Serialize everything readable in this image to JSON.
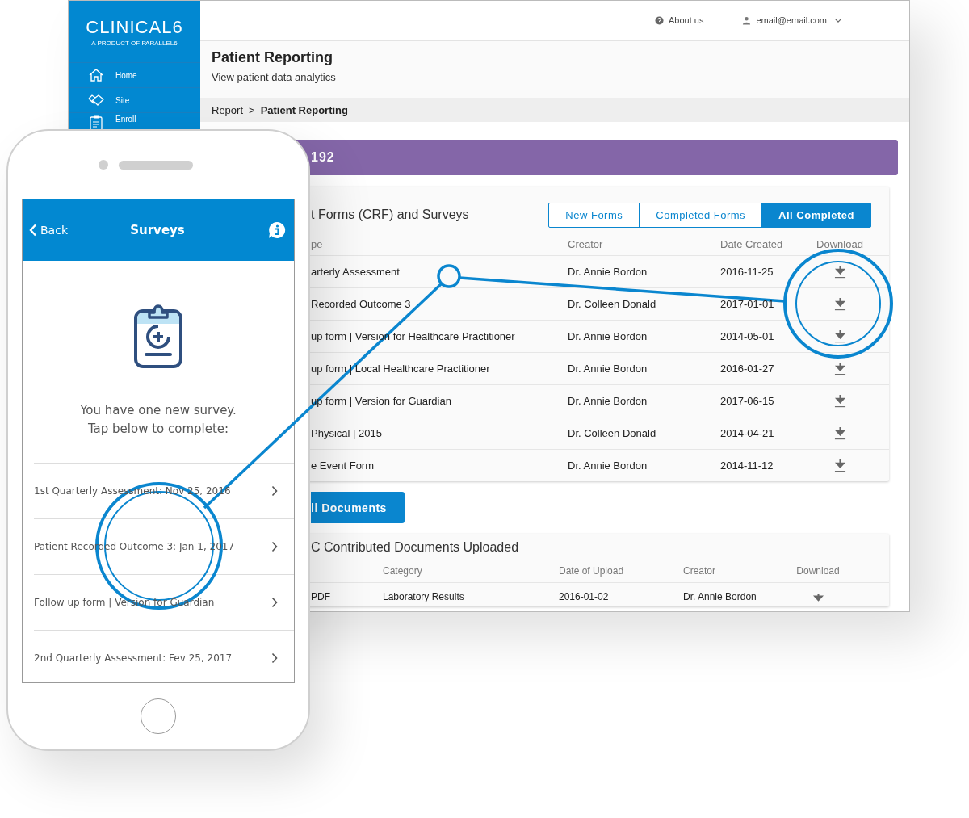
{
  "sidebar": {
    "logo": "CLINICAL6",
    "tagline": "A PRODUCT OF PARALLEL6",
    "items": [
      {
        "label": "Home",
        "kind": "home"
      },
      {
        "label": "Site",
        "kind": "handshake"
      },
      {
        "label": "Enroll",
        "kind": "clipboard"
      }
    ]
  },
  "topbar": {
    "links": [
      {
        "label": "About us",
        "kind": "help"
      },
      {
        "label": "email@email.com",
        "kind": "user"
      }
    ]
  },
  "header": {
    "title": "Patient Reporting",
    "subtitle": "View patient data analytics"
  },
  "breadcrumb": {
    "items": [
      "Report",
      "Patient Reporting"
    ],
    "separator": ">"
  },
  "banner": {
    "title": "192"
  },
  "forms_card": {
    "title": "t Forms (CRF) and Surveys",
    "tabs": [
      {
        "label": "New Forms",
        "selected": false
      },
      {
        "label": "Completed Forms",
        "selected": false
      },
      {
        "label": "All Completed",
        "selected": true
      }
    ],
    "columns": [
      "pe",
      "Creator",
      "Date Created",
      "Download"
    ],
    "rows": [
      {
        "type": "arterly Assessment",
        "creator": "Dr. Annie Bordon",
        "date": "2016-11-25"
      },
      {
        "type": "Recorded Outcome 3",
        "creator": "Dr. Colleen Donald",
        "date": "2017-01-01"
      },
      {
        "type": "up form | Version for Healthcare Practitioner",
        "creator": "Dr. Annie Bordon",
        "date": "2014-05-01"
      },
      {
        "type": "up form | Local Healthcare Practitioner",
        "creator": "Dr. Annie Bordon",
        "date": "2016-01-27"
      },
      {
        "type": "up form | Version for Guardian",
        "creator": "Dr. Annie Bordon",
        "date": "2017-06-15"
      },
      {
        "type": "Physical | 2015",
        "creator": "Dr. Colleen Donald",
        "date": "2014-04-21"
      },
      {
        "type": "e Event Form",
        "creator": "Dr. Annie Bordon",
        "date": "2014-11-12"
      }
    ]
  },
  "documents_button": "ll Documents",
  "documents_card": {
    "title": "C Contributed Documents Uploaded",
    "columns": [
      "Category",
      "Date of Upload",
      "Creator",
      "Download"
    ],
    "rows": [
      {
        "type": "PDF",
        "category": "Laboratory Results",
        "date": "2016-01-02",
        "creator": "Dr. Annie Bordon"
      }
    ]
  },
  "phone": {
    "back": "Back",
    "title": "Surveys",
    "message": [
      "You have one new survey.",
      "Tap below to complete:"
    ],
    "surveys": [
      "1st Quarterly Assessment: Nov 25, 2016",
      "Patient Recorded Outcome 3: Jan 1, 2017",
      "Follow up form | Version for Guardian",
      "2nd Quarterly Assessment: Fev 25, 2017"
    ]
  }
}
